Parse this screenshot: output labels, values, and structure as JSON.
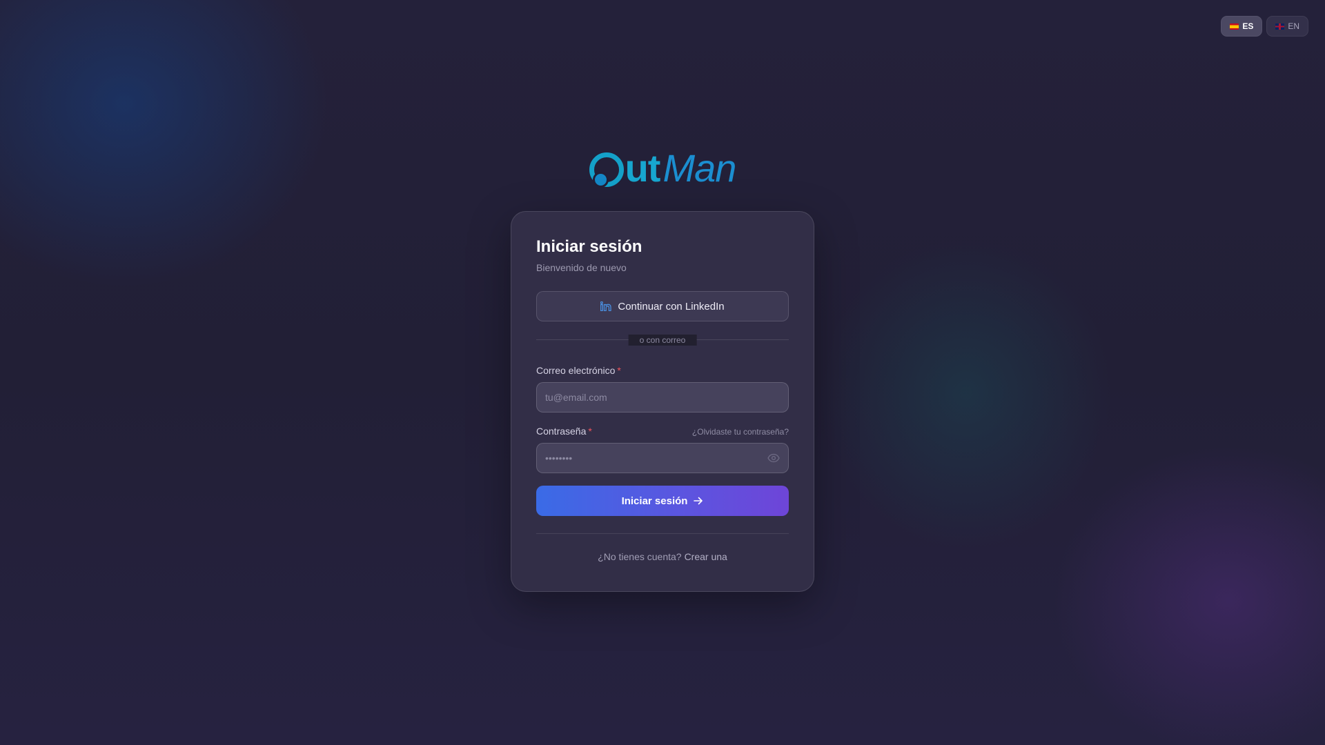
{
  "language_switch": {
    "options": [
      {
        "code": "ES",
        "active": true
      },
      {
        "code": "EN",
        "active": false
      }
    ]
  },
  "logo": {
    "part1": "ut",
    "part2": "Man"
  },
  "login": {
    "title": "Iniciar sesión",
    "subtitle": "Bienvenido de nuevo",
    "linkedin_label": "Continuar con LinkedIn",
    "divider_label": "o con correo",
    "email_label": "Correo electrónico",
    "email_placeholder": "tu@email.com",
    "email_value": "",
    "password_label": "Contraseña",
    "password_placeholder": "••••••••",
    "password_value": "",
    "required_mark": "*",
    "forgot_label": "¿Olvidaste tu contraseña?",
    "submit_label": "Iniciar sesión",
    "signup_prompt": "¿No tienes cuenta?",
    "signup_link": "Crear una"
  },
  "icons": {
    "linkedin": "linkedin-icon",
    "eye": "eye-icon",
    "arrow": "arrow-right-icon"
  },
  "colors": {
    "accent_start": "#3a6be6",
    "accent_end": "#6e45d8",
    "brand": "#17a6cf",
    "required": "#f2545b",
    "linkedin_icon": "#4a8fe0"
  }
}
